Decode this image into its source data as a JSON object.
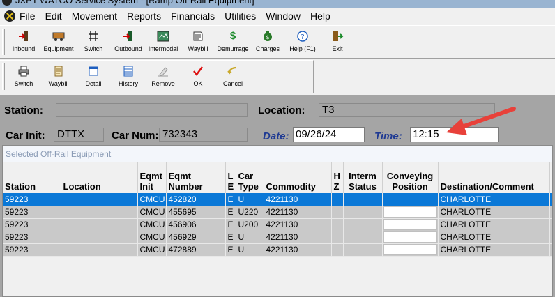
{
  "window": {
    "title": "JXPT WATCO Service System - [Ramp Off-Rail Equipment]"
  },
  "menu": [
    "File",
    "Edit",
    "Movement",
    "Reports",
    "Financials",
    "Utilities",
    "Window",
    "Help"
  ],
  "toolbar1": [
    {
      "label": "Inbound",
      "icon": "inbound-icon"
    },
    {
      "label": "Equipment",
      "icon": "equipment-icon"
    },
    {
      "label": "Switch",
      "icon": "switch-icon"
    },
    {
      "label": "Outbound",
      "icon": "outbound-icon"
    },
    {
      "label": "Intermodal",
      "icon": "intermodal-icon"
    },
    {
      "label": "Waybill",
      "icon": "waybill-icon"
    },
    {
      "label": "Demurrage",
      "icon": "demurrage-icon"
    },
    {
      "label": "Charges",
      "icon": "charges-icon"
    },
    {
      "label": "Help (F1)",
      "icon": "help-icon"
    },
    {
      "label": "Exit",
      "icon": "exit-icon"
    }
  ],
  "toolbar2": [
    {
      "label": "Switch",
      "icon": "print-switch-icon"
    },
    {
      "label": "Waybill",
      "icon": "waybill-scroll-icon"
    },
    {
      "label": "Detail",
      "icon": "detail-icon"
    },
    {
      "label": "History",
      "icon": "history-icon"
    },
    {
      "label": "Remove",
      "icon": "eraser-icon"
    },
    {
      "label": "OK",
      "icon": "check-icon"
    },
    {
      "label": "Cancel",
      "icon": "cancel-icon"
    }
  ],
  "form": {
    "station_label": "Station:",
    "station_value": "",
    "location_label": "Location:",
    "location_value": "T3",
    "car_init_label": "Car Init:",
    "car_init_value": "DTTX",
    "car_num_label": "Car Num:",
    "car_num_value": "732343",
    "date_label": "Date:",
    "date_value": "09/26/24",
    "time_label": "Time:",
    "time_value": "12:15"
  },
  "panel": {
    "title": "Selected Off-Rail Equipment",
    "columns": [
      "Station",
      "Location",
      "Eqmt Init",
      "Eqmt Number",
      "L E",
      "Car Type",
      "Commodity",
      "H Z",
      "Interm Status",
      "Conveying Position",
      "Destination/Comment"
    ],
    "rows": [
      {
        "station": "59223",
        "location": "",
        "init": "CMCU",
        "number": "452820",
        "le": "E",
        "type": "U",
        "commodity": "4221130",
        "hz": "",
        "interm": "",
        "conveying": "",
        "dest": "CHARLOTTE",
        "selected": true
      },
      {
        "station": "59223",
        "location": "",
        "init": "CMCU",
        "number": "455695",
        "le": "E",
        "type": "U220",
        "commodity": "4221130",
        "hz": "",
        "interm": "",
        "conveying": "",
        "dest": "CHARLOTTE",
        "selected": false
      },
      {
        "station": "59223",
        "location": "",
        "init": "CMCU",
        "number": "456906",
        "le": "E",
        "type": "U200",
        "commodity": "4221130",
        "hz": "",
        "interm": "",
        "conveying": "",
        "dest": "CHARLOTTE",
        "selected": false
      },
      {
        "station": "59223",
        "location": "",
        "init": "CMCU",
        "number": "456929",
        "le": "E",
        "type": "U",
        "commodity": "4221130",
        "hz": "",
        "interm": "",
        "conveying": "",
        "dest": "CHARLOTTE",
        "selected": false
      },
      {
        "station": "59223",
        "location": "",
        "init": "CMCU",
        "number": "472889",
        "le": "E",
        "type": "U",
        "commodity": "4221130",
        "hz": "",
        "interm": "",
        "conveying": "",
        "dest": "CHARLOTTE",
        "selected": false
      }
    ]
  },
  "colors": {
    "selection": "#0a78d7",
    "accent_label": "#1f3a93",
    "annotation_arrow": "#e8413a"
  }
}
